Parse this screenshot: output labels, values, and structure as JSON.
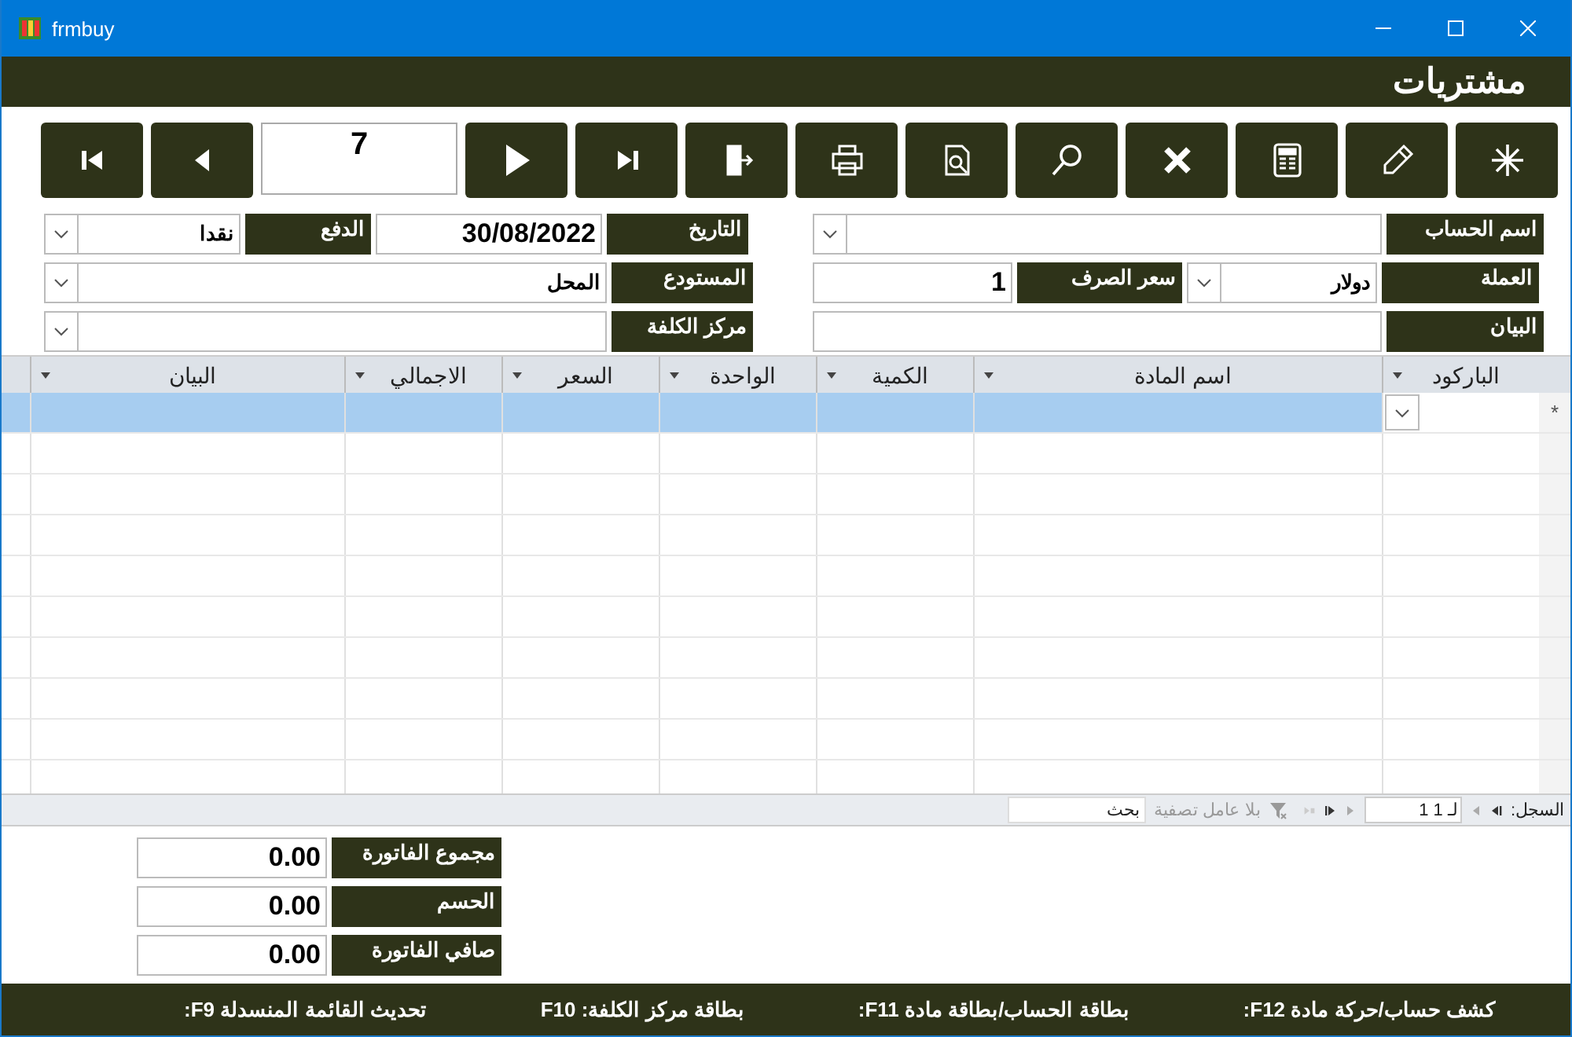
{
  "window": {
    "title": "frmbuy"
  },
  "header": {
    "title": "مشتريات"
  },
  "toolbar": {
    "record": "7"
  },
  "form": {
    "account_name": {
      "label": "اسم الحساب"
    },
    "currency": {
      "label": "العملة",
      "value": "دولار"
    },
    "exchange_rate": {
      "label": "سعر الصرف",
      "value": "1"
    },
    "description": {
      "label": "البيان"
    },
    "date": {
      "label": "التاريخ",
      "value": "30/08/2022"
    },
    "payment": {
      "label": "الدفع",
      "value": "نقدا"
    },
    "warehouse": {
      "label": "المستودع",
      "value": "المحل"
    },
    "cost_center": {
      "label": "مركز الكلفة"
    }
  },
  "table": {
    "columns": [
      "الباركود",
      "اسم المادة",
      "الكمية",
      "الواحدة",
      "السعر",
      "الاجمالي",
      "البيان"
    ],
    "new_row_marker": "*",
    "navigation": {
      "label": "السجل:",
      "record": "1 لـ 1",
      "filter": "بلا عامل تصفية",
      "search": "بحث"
    }
  },
  "totals": [
    {
      "label": "مجموع الفاتورة",
      "value": "0.00"
    },
    {
      "label": "الحسم",
      "value": "0.00"
    },
    {
      "label": "صافي الفاتورة",
      "value": "0.00"
    }
  ],
  "status_bar": [
    "كشف حساب/حركة مادة F12:",
    "بطاقة الحساب/بطاقة مادة F11:",
    "بطاقة مركز الكلفة: F10",
    "تحديث القائمة المنسدلة F9:"
  ]
}
